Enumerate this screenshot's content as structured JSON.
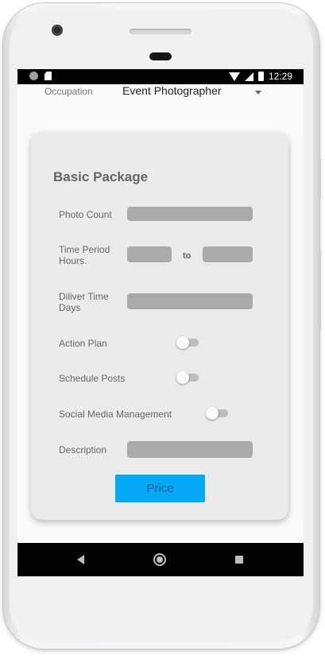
{
  "status_bar": {
    "time": "12:29"
  },
  "occupation": {
    "label": "Occupation",
    "value": "Event Photographer"
  },
  "card": {
    "title": "Basic Package",
    "photo_count_label": "Photo Count",
    "time_period_label_line1": "Time Period",
    "time_period_label_line2": "Hours.",
    "to_label": "to",
    "deliver_time_label_line1": "Diliver Time",
    "deliver_time_label_line2": "Days",
    "action_plan_label": "Action Plan",
    "action_plan_on": false,
    "schedule_posts_label": "Schedule Posts",
    "schedule_posts_on": false,
    "social_media_label": "Social Media Management",
    "social_media_on": false,
    "description_label": "Description",
    "price_button_label": "Price"
  },
  "colors": {
    "accent": "#03a9f4",
    "field": "#aaaaaa",
    "card": "#ebebeb"
  },
  "icons": [
    "wifi-icon",
    "signal-icon",
    "battery-icon",
    "back-icon",
    "home-icon",
    "recents-icon"
  ]
}
